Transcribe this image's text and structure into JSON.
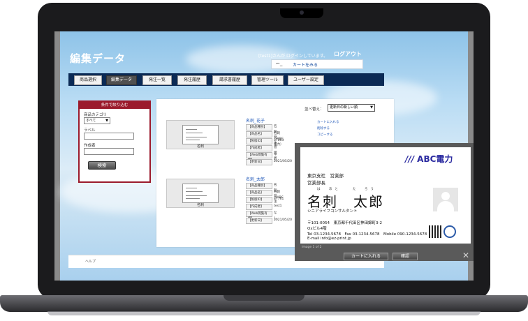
{
  "header": {
    "title": "編集データ",
    "user_status": "[test1]さんが ログインしています。",
    "logout": "ログアウト",
    "cart_link": "カートをみる",
    "cart_icon": "cart-icon"
  },
  "nav": {
    "items": [
      "商品選択",
      "編集データ",
      "発注一覧",
      "発注履歴",
      "請求書履歴",
      "管理ツール",
      "ユーザー設定"
    ],
    "active_index": 1
  },
  "filter": {
    "heading": "条件で絞り込む",
    "category_label": "商品カテゴリ",
    "category_value": "すべて",
    "label_label": "ラベル",
    "label_value": "",
    "creator_label": "作成者",
    "creator_value": "",
    "search_button": "検索"
  },
  "results": {
    "sort_label": "並べ替え：",
    "sort_value": "更新日の新しい順",
    "items": [
      {
        "name": "名刺_花子",
        "thumb_caption": "名刺",
        "rows": [
          {
            "k": "【商品種別】",
            "v": "名刺発注"
          },
          {
            "k": "【商品名】",
            "v": "名刺（ABC電力）"
          },
          {
            "k": "【製版ID】",
            "v": "87863"
          },
          {
            "k": "【作成者】",
            "v": "管理者"
          },
          {
            "k": "【Web閲覧有無】",
            "v": "なし"
          },
          {
            "k": "【更新日】",
            "v": "2021/05/20"
          }
        ],
        "actions": [
          "カートに入れる",
          "削除する",
          "コピーする"
        ]
      },
      {
        "name": "名刺_太郎",
        "thumb_caption": "名刺",
        "rows": [
          {
            "k": "【商品種別】",
            "v": "名刺発注"
          },
          {
            "k": "【商品名】",
            "v": "名刺（ABC"
          },
          {
            "k": "【製版ID】",
            "v": "87761"
          },
          {
            "k": "【作成者】",
            "v": "test1"
          },
          {
            "k": "【Web閲覧有無】",
            "v": "なし"
          },
          {
            "k": "【更新日】",
            "v": "2021/05/20"
          }
        ],
        "actions": []
      }
    ]
  },
  "footer": {
    "help": "ヘルプ"
  },
  "modal": {
    "company": "ABC電力",
    "company_mark": "///",
    "dept": "東京支社　営業部",
    "title": "営業部長",
    "furigana": "は　あと　　た　ろう",
    "name": "名刺　太郎",
    "job": "シニアライフコンサルタント",
    "address1": "〒101-0054　東京都千代田区神田錦町3-2",
    "address2": "Oxビル4階",
    "phone": "Tel 03-1234-5678　Fax 03-1234-5678　Mobile 090-1234-5678",
    "email": "E-mail info@ez-print.jp",
    "page": "Image 1 of 2",
    "cart_button": "カートに入れる",
    "confirm_button": "確認",
    "close": "✕"
  }
}
